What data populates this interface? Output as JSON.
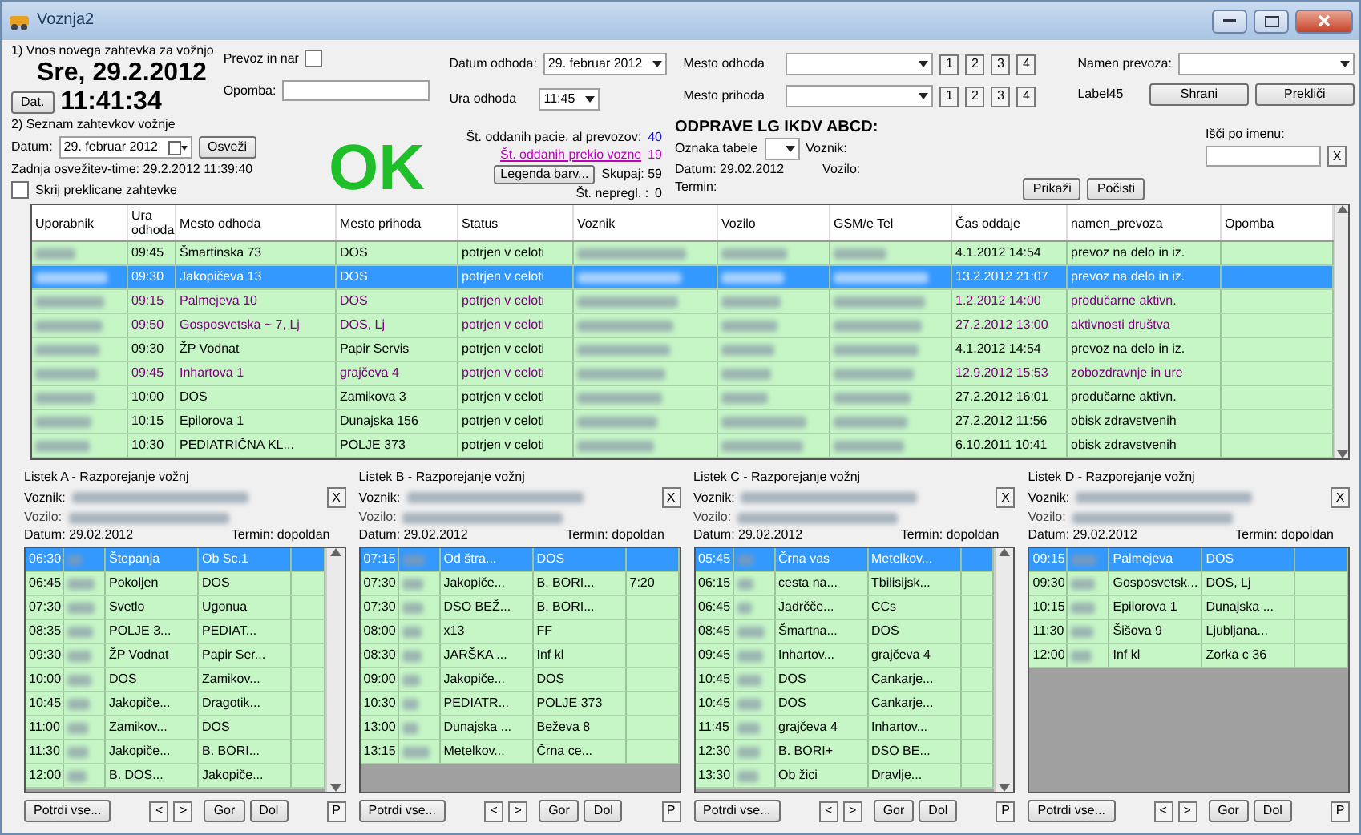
{
  "window": {
    "title": "Voznja2"
  },
  "new_request": {
    "caption": "1) Vnos novega zahtevka za vožnjo",
    "date": "Sre, 29.2.2012",
    "date_button": "Dat.",
    "time": "11:41:34",
    "transfer_label": "Prevoz in nar",
    "transfer_checked": false,
    "note_label": "Opomba:",
    "departure_date_label": "Datum odhoda:",
    "departure_date": "29.  februar  2012",
    "departure_time_label": "Ura odhoda",
    "departure_time": "11:45",
    "places": [
      {
        "label": "Mesto odhoda",
        "buttons": [
          "1",
          "2",
          "3",
          "4"
        ]
      },
      {
        "label": "Mesto prihoda",
        "buttons": [
          "1",
          "2",
          "3",
          "4"
        ]
      }
    ],
    "purpose_label": "Namen prevoza:",
    "extra_label": "Label45",
    "save": "Shrani",
    "cancel": "Prekliči"
  },
  "request_list": {
    "caption": "2) Seznam zahtevkov vožnje",
    "date_label": "Datum:",
    "date": "29.  februar  2012",
    "refresh": "Osveži",
    "last_refresh": "Zadnja osvežitev-time: 29.2.2012 11:39:40",
    "hide_label": "Skrij preklicane zahtevke",
    "hide_checked": false,
    "status_text": "OK",
    "stats": [
      {
        "kind": "count",
        "label": "Št. oddanih pacie. al prevozov:",
        "value": "40"
      },
      {
        "kind": "link",
        "label": "Št. oddanih prekio vozne",
        "value": "19"
      },
      {
        "kind": "button",
        "label": "Legenda barv...",
        "value": "Skupaj:  59"
      },
      {
        "kind": "plain",
        "label": "Št. nepregl. :",
        "value": "0"
      }
    ],
    "dispatch": {
      "title": "ODPRAVE LG IKDV ABCD:",
      "table_label": "Oznaka tabele",
      "driver_label": "Voznik:",
      "date": "Datum:  29.02.2012",
      "vehicle_label": "Vozilo:",
      "term_label": "Termin:"
    },
    "show": "Prikaži",
    "clear": "Počisti",
    "search_label": "Išči po imenu:",
    "search_clear": "X"
  },
  "table": {
    "columns": [
      {
        "label": "Uporabnik"
      },
      {
        "label": "Ura odhoda"
      },
      {
        "label": "Mesto odhoda"
      },
      {
        "label": "Mesto prihoda"
      },
      {
        "label": "Status"
      },
      {
        "label": "Voznik"
      },
      {
        "label": "Vozilo"
      },
      {
        "label": "GSM/e Tel"
      },
      {
        "label": "Čas oddaje"
      },
      {
        "label": "namen_prevoza"
      },
      {
        "label": "Opomba"
      }
    ],
    "rows": [
      {
        "selected": false,
        "color": "#000000",
        "cells": [
          "",
          "09:45",
          "Šmartinska 73",
          "DOS",
          "potrjen v celoti",
          "",
          "",
          "",
          "4.1.2012 14:54",
          "prevoz na delo in iz.",
          ""
        ]
      },
      {
        "selected": true,
        "cells": [
          "",
          "09:30",
          "Jakopičeva 13",
          "DOS",
          "potrjen v celoti",
          "",
          "",
          "",
          "13.2.2012 21:07",
          "prevoz na delo in iz.",
          ""
        ]
      },
      {
        "selected": false,
        "color": "#800080",
        "cells": [
          "",
          "09:15",
          "Palmejeva 10",
          "DOS",
          "potrjen v celoti",
          "",
          "",
          "",
          "1.2.2012 14:00",
          "produčarne aktivn.",
          ""
        ]
      },
      {
        "selected": false,
        "color": "#800080",
        "cells": [
          "",
          "09:50",
          "Gosposvetska ~ 7, Lj",
          "DOS, Lj",
          "potrjen v celoti",
          "",
          "",
          "",
          "27.2.2012 13:00",
          "aktivnosti društva",
          ""
        ]
      },
      {
        "selected": false,
        "color": "#000000",
        "cells": [
          "",
          "09:30",
          "ŽP Vodnat",
          "Papir Servis",
          "potrjen v celoti",
          "",
          "",
          "",
          "4.1.2012 14:54",
          "prevoz na delo in iz.",
          ""
        ]
      },
      {
        "selected": false,
        "color": "#800080",
        "cells": [
          "",
          "09:45",
          "Inhartova 1",
          "grajčeva 4",
          "potrjen v celoti",
          "",
          "",
          "",
          "12.9.2012 15:53",
          "zobozdravnje in ure",
          ""
        ]
      },
      {
        "selected": false,
        "color": "#000000",
        "cells": [
          "",
          "10:00",
          "DOS",
          "Zamikova 3",
          "potrjen v celoti",
          "",
          "",
          "",
          "27.2.2012 16:01",
          "produčarne aktivn.",
          ""
        ]
      },
      {
        "selected": false,
        "color": "#000000",
        "cells": [
          "",
          "10:15",
          "Epilorova 1",
          "Dunajska 156",
          "potrjen v celoti",
          "",
          "",
          "",
          "27.2.2012 11:56",
          "obisk zdravstvenih",
          ""
        ]
      },
      {
        "selected": false,
        "color": "#000000",
        "cells": [
          "",
          "10:30",
          "PEDIATRIČNA KL...",
          "POLJE 373",
          "potrjen v celoti",
          "",
          "",
          "",
          "6.10.2011 10:41",
          "obisk zdravstvenih",
          ""
        ]
      }
    ]
  },
  "panels": [
    {
      "title": "Listek A - Razporejanje vožnj",
      "driver_label": "Voznik:",
      "vehicle_label": "Vozilo:",
      "date": "Datum:  29.02.2012",
      "term": "Termin:   dopoldan",
      "close": "X",
      "rows": [
        {
          "selected": true,
          "cells": [
            "06:30",
            "Štepanja",
            "Ob Sc.1"
          ]
        },
        {
          "selected": false,
          "cells": [
            "06:45",
            "Pokoljen",
            "DOS"
          ]
        },
        {
          "selected": false,
          "cells": [
            "07:30",
            "Svetlo",
            "Ugonua"
          ]
        },
        {
          "selected": false,
          "cells": [
            "08:35",
            "POLJE 3...",
            "PEDIAT..."
          ]
        },
        {
          "selected": false,
          "cells": [
            "09:30",
            "ŽP Vodnat",
            "Papir Ser..."
          ]
        },
        {
          "selected": false,
          "cells": [
            "10:00",
            "DOS",
            "Zamikov..."
          ]
        },
        {
          "selected": false,
          "cells": [
            "10:45",
            "Jakopiče...",
            "Dragotik..."
          ]
        },
        {
          "selected": false,
          "cells": [
            "11:00",
            "Zamikov...",
            "DOS"
          ]
        },
        {
          "selected": false,
          "cells": [
            "11:30",
            "Jakopiče...",
            "B. BORI..."
          ]
        },
        {
          "selected": false,
          "cells": [
            "12:00",
            "B. DOS...",
            "Jakopiče..."
          ]
        }
      ],
      "buttons": [
        "Potrdi vse...",
        "<",
        ">",
        "Gor",
        "Dol",
        "P"
      ]
    },
    {
      "title": "Listek B - Razporejanje vožnj",
      "driver_label": "Voznik:",
      "vehicle_label": "Vozilo:",
      "date": "Datum:  29.02.2012",
      "term": "Termin:   dopoldan",
      "close": "X",
      "rows": [
        {
          "selected": true,
          "cells": [
            "07:15",
            "Od štra...",
            "DOS"
          ]
        },
        {
          "selected": false,
          "cells": [
            "07:30",
            "Jakopiče...",
            "B. BORI...",
            "7:20"
          ]
        },
        {
          "selected": false,
          "cells": [
            "07:30",
            "DSO BEŽ...",
            "B. BORI..."
          ]
        },
        {
          "selected": false,
          "cells": [
            "08:00",
            "x13",
            "FF"
          ]
        },
        {
          "selected": false,
          "cells": [
            "08:30",
            "JARŠKA ...",
            "Inf kl"
          ]
        },
        {
          "selected": false,
          "cells": [
            "09:00",
            "Jakopiče...",
            "DOS"
          ]
        },
        {
          "selected": false,
          "cells": [
            "10:30",
            "PEDIATR...",
            "POLJE 373"
          ]
        },
        {
          "selected": false,
          "cells": [
            "13:00",
            "Dunajska ...",
            "Beževa 8"
          ]
        },
        {
          "selected": false,
          "cells": [
            "13:15",
            "Metelkov...",
            "Črna ce..."
          ]
        }
      ],
      "buttons": [
        "Potrdi vse...",
        "<",
        ">",
        "Gor",
        "Dol",
        "P"
      ]
    },
    {
      "title": "Listek C - Razporejanje vožnj",
      "driver_label": "Voznik:",
      "vehicle_label": "Vozilo:",
      "date": "Datum:  29.02.2012",
      "term": "Termin:   dopoldan",
      "close": "X",
      "rows": [
        {
          "selected": true,
          "cells": [
            "05:45",
            "Črna vas",
            "Metelkov..."
          ]
        },
        {
          "selected": false,
          "cells": [
            "06:15",
            "cesta na...",
            "Tbilisijsk..."
          ]
        },
        {
          "selected": false,
          "cells": [
            "06:45",
            "Jadrčče...",
            "CCs"
          ]
        },
        {
          "selected": false,
          "cells": [
            "08:45",
            "Šmartna...",
            "DOS"
          ]
        },
        {
          "selected": false,
          "cells": [
            "09:45",
            "Inhartov...",
            "grajčeva 4"
          ]
        },
        {
          "selected": false,
          "cells": [
            "10:45",
            "DOS",
            "Cankarje..."
          ]
        },
        {
          "selected": false,
          "cells": [
            "10:45",
            "DOS",
            "Cankarje..."
          ]
        },
        {
          "selected": false,
          "cells": [
            "11:45",
            "grajčeva 4",
            "Inhartov..."
          ]
        },
        {
          "selected": false,
          "cells": [
            "12:30",
            "B. BORI+",
            "DSO BE..."
          ]
        },
        {
          "selected": false,
          "cells": [
            "13:30",
            "Ob žici",
            "Dravlje..."
          ]
        }
      ],
      "buttons": [
        "Potrdi vse...",
        "<",
        ">",
        "Gor",
        "Dol",
        "P"
      ]
    },
    {
      "title": "Listek D - Razporejanje vožnj",
      "driver_label": "Voznik:",
      "vehicle_label": "Vozilo:",
      "date": "Datum:  29.02.2012",
      "term": "Termin:   dopoldan",
      "close": "X",
      "rows": [
        {
          "selected": true,
          "cells": [
            "09:15",
            "Palmejeva",
            "DOS"
          ]
        },
        {
          "selected": false,
          "cells": [
            "09:30",
            "Gosposvetsk...",
            "DOS, Lj"
          ]
        },
        {
          "selected": false,
          "cells": [
            "10:15",
            "Epilorova 1",
            "Dunajska ..."
          ]
        },
        {
          "selected": false,
          "cells": [
            "11:30",
            "Šišova 9",
            "Ljubljana..."
          ]
        },
        {
          "selected": false,
          "cells": [
            "12:00",
            "Inf kl",
            "Zorka c 36"
          ]
        }
      ],
      "buttons": [
        "Potrdi vse...",
        "<",
        ">",
        "Gor",
        "Dol",
        "P"
      ]
    }
  ]
}
